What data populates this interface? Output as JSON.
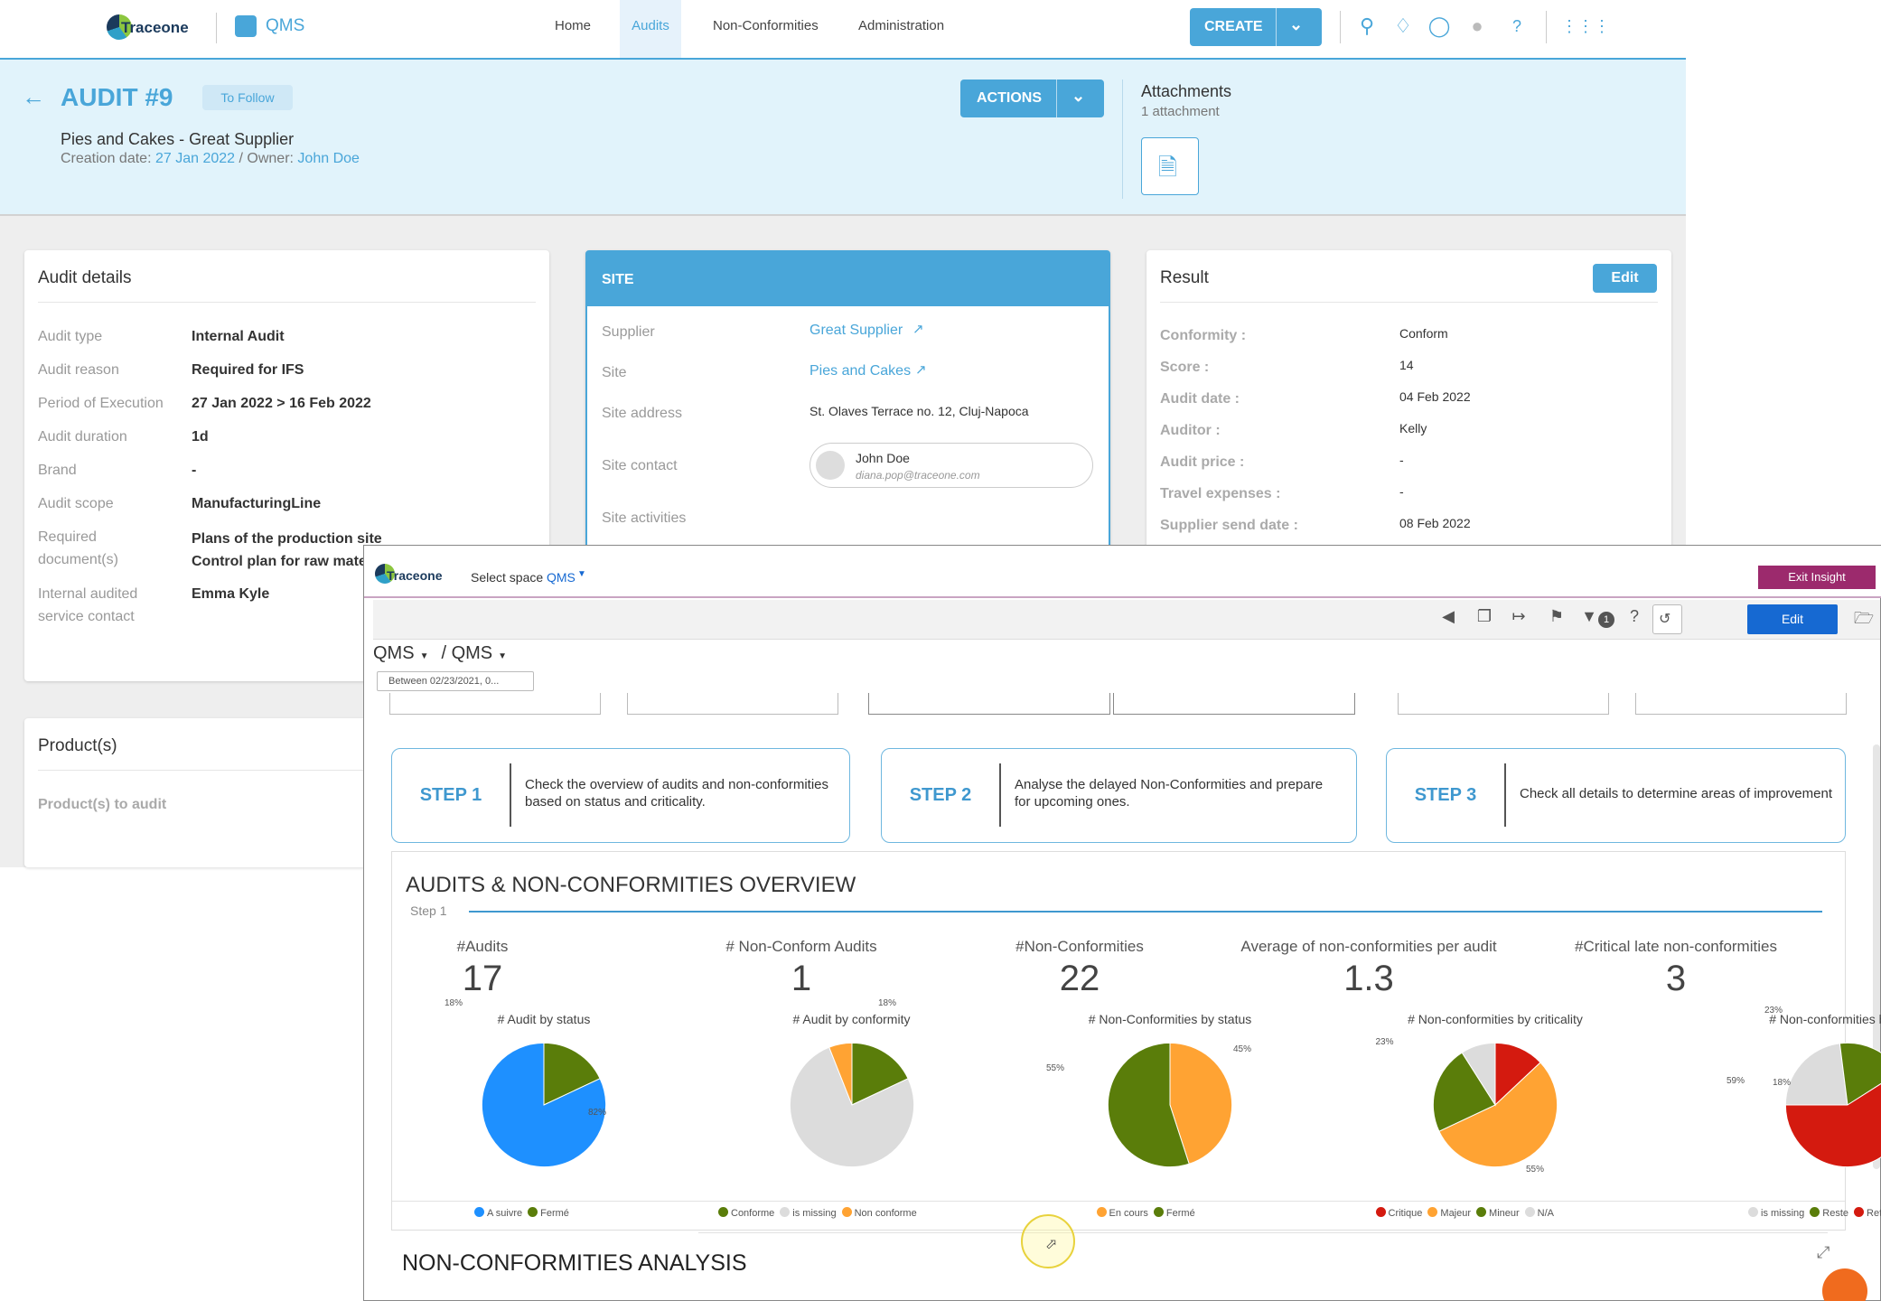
{
  "nav": {
    "brand": "Traceone",
    "app": "QMS",
    "links": [
      "Home",
      "Audits",
      "Non-Conformities",
      "Administration"
    ],
    "create_label": "CREATE"
  },
  "header": {
    "title": "AUDIT #9",
    "tag": "To Follow",
    "subtitle": "Pies and Cakes - Great Supplier",
    "creation_label": "Creation date:",
    "creation_date": "27 Jan 2022",
    "owner_sep": "/ Owner:",
    "owner": "John Doe",
    "actions_label": "ACTIONS",
    "attachments_title": "Attachments",
    "attachments_count": "1 attachment"
  },
  "audit_details": {
    "title": "Audit details",
    "rows": [
      {
        "label": "Audit type",
        "value": "Internal Audit"
      },
      {
        "label": "Audit reason",
        "value": "Required for IFS"
      },
      {
        "label": "Period of Execution",
        "value": "27 Jan 2022 > 16 Feb 2022"
      },
      {
        "label": "Audit duration",
        "value": "1d"
      },
      {
        "label": "Brand",
        "value": "-"
      },
      {
        "label": "Audit scope",
        "value": "ManufacturingLine"
      }
    ],
    "required_label_1": "Required",
    "required_label_2": "document(s)",
    "required_value_1": "Plans of the production site",
    "required_value_2": "Control plan for raw mate",
    "contact_label_1": "Internal audited",
    "contact_label_2": "service contact",
    "contact_value": "Emma Kyle"
  },
  "products": {
    "title": "Product(s)",
    "label": "Product(s) to audit"
  },
  "site": {
    "title": "SITE",
    "supplier_label": "Supplier",
    "supplier_value": "Great Supplier",
    "site_label": "Site",
    "site_value": "Pies and Cakes",
    "address_label": "Site address",
    "address_value": "St. Olaves Terrace no. 12, Cluj-Napoca",
    "contact_label": "Site contact",
    "contact_name": "John Doe",
    "contact_email": "diana.pop@traceone.com",
    "activities_label": "Site activities"
  },
  "result": {
    "title": "Result",
    "edit_label": "Edit",
    "rows": [
      {
        "label": "Conformity :",
        "value": "Conform"
      },
      {
        "label": "Score :",
        "value": "14"
      },
      {
        "label": "Audit date :",
        "value": "04 Feb 2022"
      },
      {
        "label": "Auditor :",
        "value": "Kelly"
      },
      {
        "label": "Audit price :",
        "value": "-"
      },
      {
        "label": "Travel expenses :",
        "value": "-"
      },
      {
        "label": "Supplier send date :",
        "value": "08 Feb 2022"
      }
    ]
  },
  "insight": {
    "brand": "Traceone",
    "select_space_label": "Select space",
    "space": "QMS",
    "exit_label": "Exit Insight",
    "edit_label": "Edit",
    "filter_count": "1",
    "breadcrumb_1": "QMS",
    "breadcrumb_2": "/ QMS",
    "date_filter": "Between 02/23/2021, 0...",
    "steps": [
      {
        "num": "STEP 1",
        "text_1": "Check the overview of audits and non-conformities",
        "text_2": "based on status and criticality."
      },
      {
        "num": "STEP 2",
        "text_1": "Analyse the delayed Non-Conformities and prepare",
        "text_2": "for upcoming ones."
      },
      {
        "num": "STEP 3",
        "text_1": "Check all details to determine areas of improvement",
        "text_2": ""
      }
    ],
    "overview_title": "AUDITS & NON-CONFORMITIES OVERVIEW",
    "overview_step": "Step 1",
    "kpis": [
      {
        "label": "#Audits",
        "value": "17"
      },
      {
        "label": "# Non-Conform Audits",
        "value": "1"
      },
      {
        "label": "#Non-Conformities",
        "value": "22"
      },
      {
        "label": "Average of non-conformities per audit",
        "value": "1.3"
      },
      {
        "label": "#Critical late non-conformities",
        "value": "3"
      }
    ],
    "analysis_title": "NON-CONFORMITIES ANALYSIS"
  },
  "colors": {
    "accent": "#49a6d9",
    "blue": "#1e90ff",
    "green": "#5a7d0a",
    "orange": "#ffa333",
    "grey": "#dcdcdc",
    "red": "#d41a0f"
  },
  "chart_data": [
    {
      "type": "pie",
      "title": "# Audit by status",
      "categories": [
        "A suivre",
        "Fermé"
      ],
      "values": [
        82,
        18
      ],
      "labels": [
        "82%",
        "18%"
      ]
    },
    {
      "type": "pie",
      "title": "# Audit by conformity",
      "categories": [
        "Conforme",
        "is missing",
        "Non conforme"
      ],
      "values": [
        18,
        76,
        6
      ],
      "labels": [
        "18%"
      ]
    },
    {
      "type": "pie",
      "title": "# Non-Conformities by status",
      "categories": [
        "En cours",
        "Fermé"
      ],
      "values": [
        45,
        55
      ],
      "labels": [
        "45%",
        "55%"
      ]
    },
    {
      "type": "pie",
      "title": "# Non-conformities by criticality",
      "categories": [
        "Critique",
        "Majeur",
        "Mineur",
        "N/A"
      ],
      "values": [
        13,
        55,
        23,
        9
      ],
      "labels": [
        "55%",
        "23%"
      ]
    },
    {
      "type": "pie",
      "title": "# Non-conformities by delay",
      "categories": [
        "is missing",
        "Reste",
        "Retard"
      ],
      "values": [
        23,
        18,
        59
      ],
      "labels": [
        "23%",
        "18%",
        "59%"
      ]
    }
  ]
}
